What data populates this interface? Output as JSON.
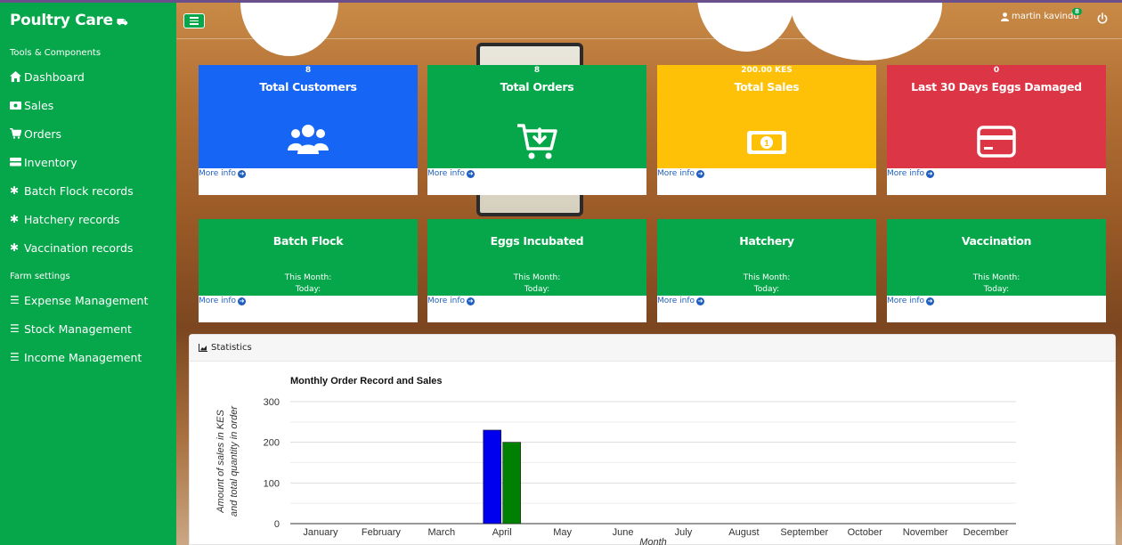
{
  "sidebar": {
    "brand": "Poultry Care",
    "sections": [
      {
        "label": "Tools & Components"
      },
      {
        "label": "Farm settings"
      }
    ],
    "items": [
      {
        "label": "Dashboard",
        "icon": "home-icon"
      },
      {
        "label": "Sales",
        "icon": "money-icon"
      },
      {
        "label": "Orders",
        "icon": "cart-icon"
      },
      {
        "label": "Inventory",
        "icon": "inventory-icon"
      },
      {
        "label": "Batch Flock records",
        "icon": "asterisk-icon"
      },
      {
        "label": "Hatchery records",
        "icon": "asterisk-icon"
      },
      {
        "label": "Vaccination records",
        "icon": "asterisk-icon"
      },
      {
        "label": "Expense Management",
        "icon": "list-icon"
      },
      {
        "label": "Stock Management",
        "icon": "list-icon"
      },
      {
        "label": "Income Management",
        "icon": "list-icon"
      }
    ]
  },
  "header": {
    "user": "martin kavindu",
    "badge": "8"
  },
  "cards": [
    {
      "count": "8",
      "title": "Total Customers",
      "more": "More info",
      "color": "#1665f5",
      "icon": "users-icon"
    },
    {
      "count": "8",
      "title": "Total Orders",
      "more": "More info",
      "color": "#06a64a",
      "icon": "cart-download-icon"
    },
    {
      "count": "200.00 KES",
      "title": "Total Sales",
      "more": "More info",
      "color": "#ffc107",
      "icon": "money-bill-icon"
    },
    {
      "count": "0",
      "title": "Last 30 Days Eggs Damaged",
      "more": "More info",
      "color": "#dc3545",
      "icon": "credit-card-icon"
    }
  ],
  "cards2": [
    {
      "title": "Batch Flock",
      "month": "This Month:",
      "today": "Today:",
      "more": "More info"
    },
    {
      "title": "Eggs Incubated",
      "month": "This Month:",
      "today": "Today:",
      "more": "More info"
    },
    {
      "title": "Hatchery",
      "month": "This Month:",
      "today": "Today:",
      "more": "More info"
    },
    {
      "title": "Vaccination",
      "month": "This Month:",
      "today": "Today:",
      "more": "More info"
    }
  ],
  "stats": {
    "header": "Statistics"
  },
  "chart_data": {
    "type": "bar",
    "title": "Monthly Order Record and Sales",
    "ylabel_line1": "Amount of sales in KES",
    "ylabel_line2": "and total quantity in order",
    "xlabel": "Month",
    "categories": [
      "January",
      "February",
      "March",
      "April",
      "May",
      "June",
      "July",
      "August",
      "September",
      "October",
      "November",
      "December"
    ],
    "series": [
      {
        "values": [
          0,
          0,
          0,
          230,
          0,
          0,
          0,
          0,
          0,
          0,
          0,
          0
        ],
        "color": "#0000ee"
      },
      {
        "values": [
          0,
          0,
          0,
          200,
          0,
          0,
          0,
          0,
          0,
          0,
          0,
          0
        ],
        "color": "#008000"
      }
    ],
    "ylim": [
      0,
      300
    ],
    "yticks": [
      0,
      100,
      200,
      300
    ],
    "grid": true
  }
}
